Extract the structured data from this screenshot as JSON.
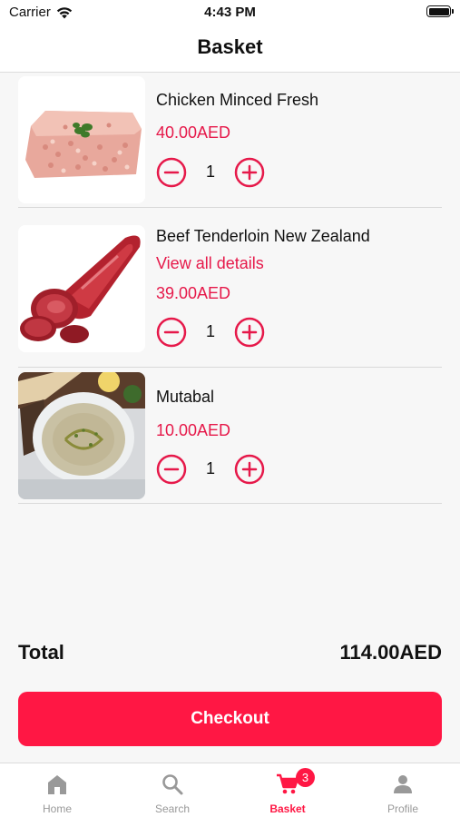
{
  "status_bar": {
    "carrier": "Carrier",
    "time": "4:43 PM"
  },
  "header": {
    "title": "Basket"
  },
  "items": [
    {
      "name": "Chicken Minced Fresh",
      "price": "40.00AED",
      "quantity": "1",
      "image": "minced-chicken-image"
    },
    {
      "name": "Beef Tenderloin New Zealand",
      "details_link": "View all details",
      "price": "39.00AED",
      "quantity": "1",
      "image": "beef-tenderloin-image"
    },
    {
      "name": "Mutabal",
      "price": "10.00AED",
      "quantity": "1",
      "image": "mutabal-dip-image"
    }
  ],
  "summary": {
    "total_label": "Total",
    "total_value": "114.00AED"
  },
  "checkout": {
    "label": "Checkout"
  },
  "tab_bar": {
    "tabs": [
      {
        "label": "Home",
        "icon": "home-icon"
      },
      {
        "label": "Search",
        "icon": "search-icon"
      },
      {
        "label": "Basket",
        "icon": "cart-icon",
        "badge": "3",
        "active": true
      },
      {
        "label": "Profile",
        "icon": "person-icon"
      }
    ]
  },
  "colors": {
    "accent": "#ff1744",
    "price": "#e6194a",
    "inactive_tab": "#999999"
  }
}
